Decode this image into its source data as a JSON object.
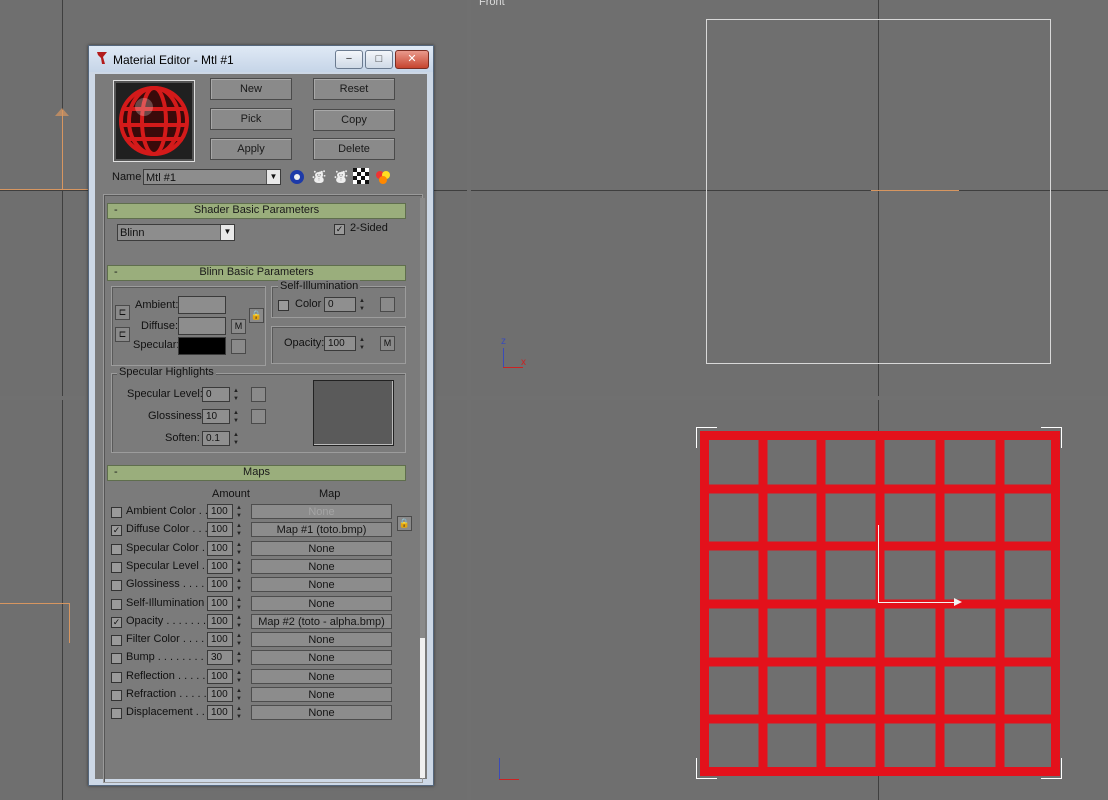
{
  "viewports": {
    "front_label": "Front"
  },
  "window": {
    "title": "Material Editor - Mtl #1",
    "minimize": "−",
    "maximize": "□",
    "close": "✕"
  },
  "buttons": {
    "new": "New",
    "reset": "Reset",
    "pick": "Pick",
    "copy": "Copy",
    "apply": "Apply",
    "delete": "Delete"
  },
  "name_row": {
    "label": "Name",
    "value": "Mtl #1"
  },
  "shader": {
    "header": "Shader Basic Parameters",
    "shader_type": "Blinn",
    "two_sided_label": "2-Sided",
    "two_sided_checked": "✓"
  },
  "blinn": {
    "header": "Blinn Basic Parameters",
    "ambient_label": "Ambient:",
    "diffuse_label": "Diffuse:",
    "specular_label": "Specular:",
    "m_label": "M",
    "self_illum_title": "Self-Illumination",
    "color_label": "Color",
    "color_value": "0",
    "opacity_label": "Opacity:",
    "opacity_value": "100",
    "opacity_m": "M"
  },
  "specular_highlights": {
    "title": "Specular Highlights",
    "level_label": "Specular Level:",
    "level_value": "0",
    "gloss_label": "Glossiness:",
    "gloss_value": "10",
    "soften_label": "Soften:",
    "soften_value": "0.1"
  },
  "maps": {
    "header": "Maps",
    "col_amount": "Amount",
    "col_map": "Map",
    "rows": [
      {
        "label": "Ambient Color . . .",
        "checked": "",
        "amount": "100",
        "map": "None",
        "dim": true
      },
      {
        "label": "Diffuse Color . . . .",
        "checked": "✓",
        "amount": "100",
        "map": "Map #1 (toto.bmp)",
        "dim": false
      },
      {
        "label": "Specular Color . .",
        "checked": "",
        "amount": "100",
        "map": "None",
        "dim": false
      },
      {
        "label": "Specular Level . .",
        "checked": "",
        "amount": "100",
        "map": "None",
        "dim": false
      },
      {
        "label": "Glossiness . . . . . .",
        "checked": "",
        "amount": "100",
        "map": "None",
        "dim": false
      },
      {
        "label": "Self-Illumination .",
        "checked": "",
        "amount": "100",
        "map": "None",
        "dim": false
      },
      {
        "label": "Opacity . . . . . . . .",
        "checked": "✓",
        "amount": "100",
        "map": "Map #2 (toto - alpha.bmp)",
        "dim": false
      },
      {
        "label": "Filter Color . . . . .",
        "checked": "",
        "amount": "100",
        "map": "None",
        "dim": false
      },
      {
        "label": "Bump . . . . . . . . .",
        "checked": "",
        "amount": "30",
        "map": "None",
        "dim": false
      },
      {
        "label": "Reflection . . . . . .",
        "checked": "",
        "amount": "100",
        "map": "None",
        "dim": false
      },
      {
        "label": "Refraction . . . . . .",
        "checked": "",
        "amount": "100",
        "map": "None",
        "dim": false
      },
      {
        "label": "Displacement . .",
        "checked": "",
        "amount": "100",
        "map": "None",
        "dim": false
      }
    ]
  },
  "colors": {
    "grid_red": "#e3111b",
    "rollout_green": "#9aae7c",
    "axis_orange": "#d79660"
  }
}
